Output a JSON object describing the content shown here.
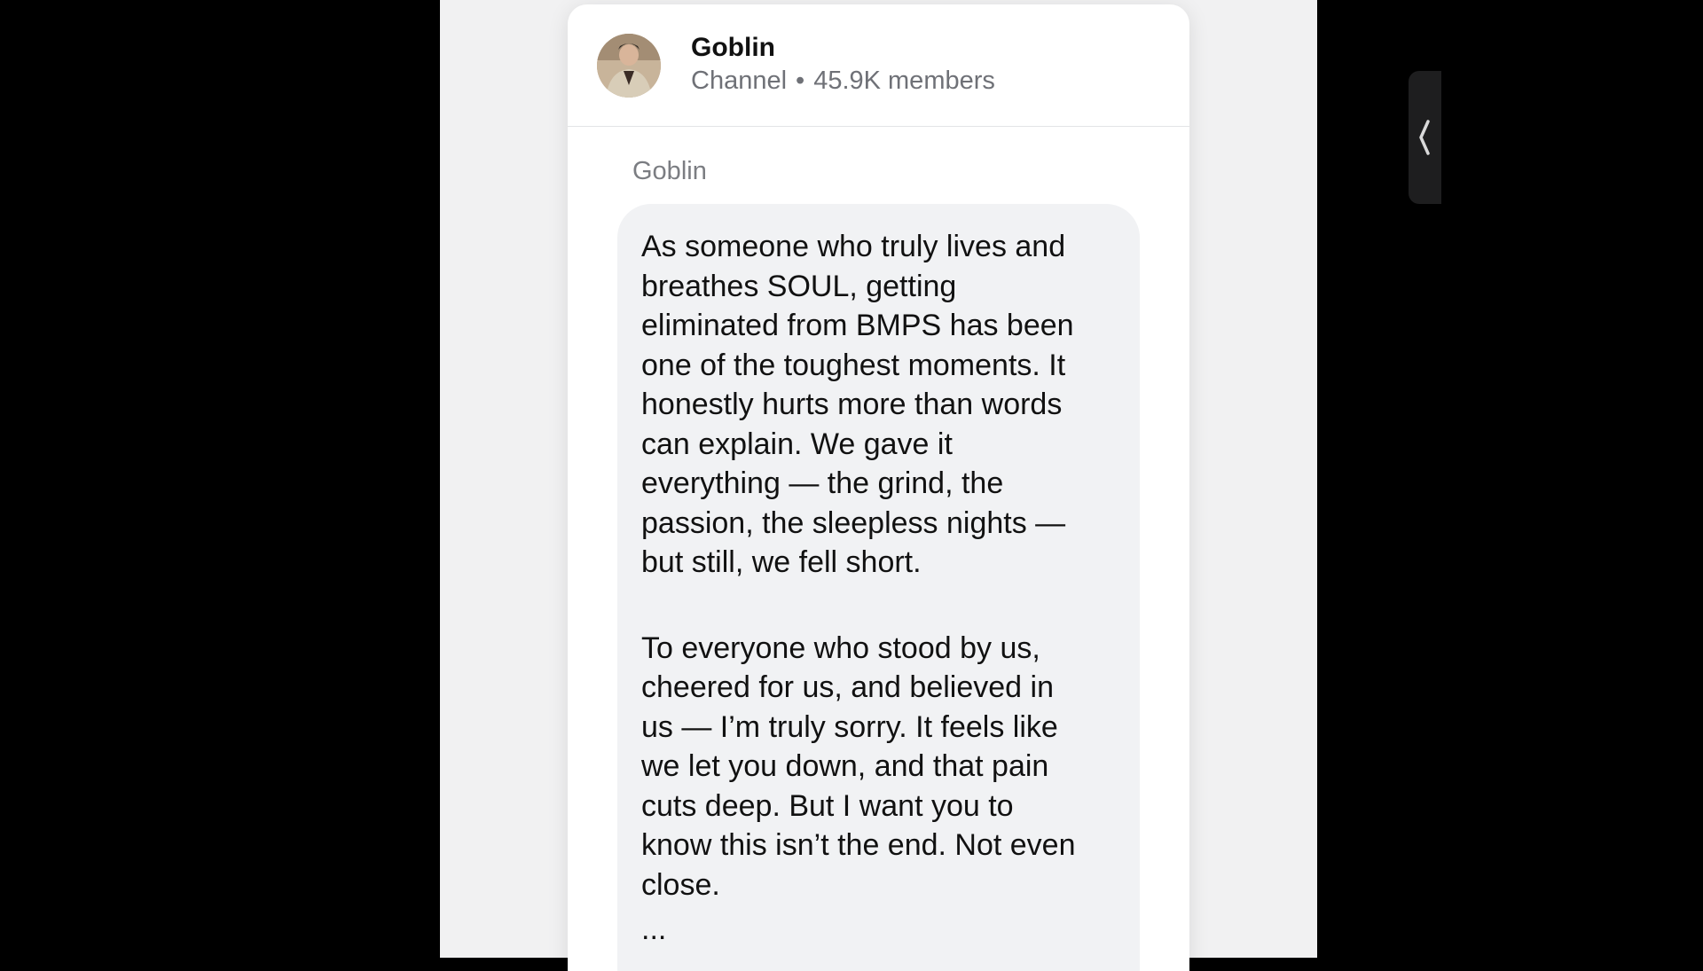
{
  "channel": {
    "name": "Goblin",
    "type": "Channel",
    "separator": "•",
    "members": "45.9K members"
  },
  "message": {
    "sender": "Goblin",
    "paragraph1": "As someone who truly lives and\nbreathes SOUL, getting\neliminated from BMPS has been\none of the toughest moments. It\nhonestly hurts more than words\ncan explain. We gave it\neverything — the grind, the\npassion, the sleepless nights —\nbut still, we fell short.",
    "paragraph2": "To everyone who stood by us,\ncheered for us, and believed in\nus — I’m truly sorry. It feels like\nwe let you down, and that pain\ncuts deep. But I want you to\nknow this isn’t the end. Not even\nclose.",
    "ellipsis": "..."
  },
  "icons": {
    "side_tab": "chevron-left-icon"
  },
  "colors": {
    "bubble": "#f1f2f4",
    "meta_text": "#6f7177"
  }
}
